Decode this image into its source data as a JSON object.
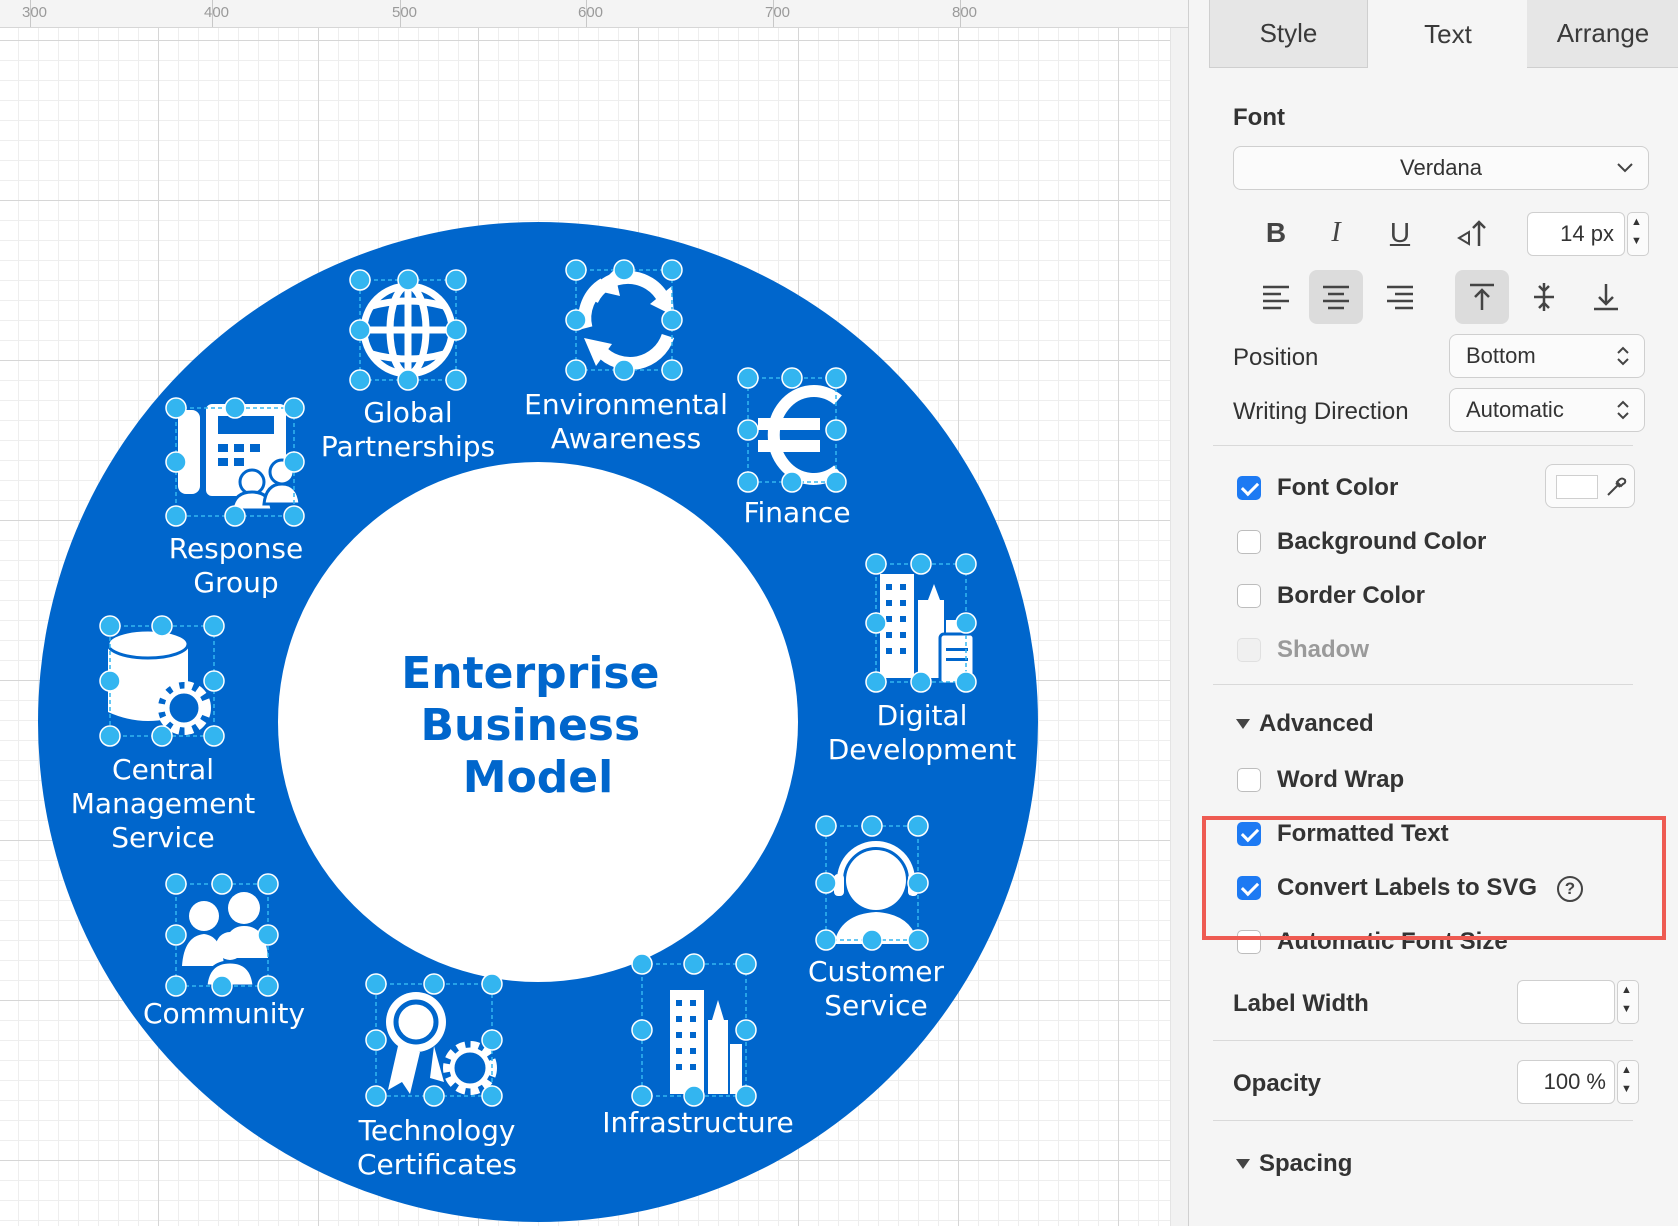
{
  "ruler": {
    "marks": [
      "300",
      "400",
      "500",
      "600",
      "700",
      "800"
    ]
  },
  "diagram": {
    "center_title": [
      "Enterprise",
      "Business",
      "Model"
    ],
    "ring_color": "#0066cc",
    "handle_color": "#33b5f0",
    "nodes": [
      {
        "id": "global-partnerships",
        "icon": "globe-icon",
        "label": [
          "Global",
          "Partnerships"
        ]
      },
      {
        "id": "environmental-awareness",
        "icon": "recycle-arrows-icon",
        "label": [
          "Environmental",
          "Awareness"
        ]
      },
      {
        "id": "finance",
        "icon": "euro-icon",
        "label": [
          "Finance"
        ]
      },
      {
        "id": "digital-development",
        "icon": "city-buildings-icon",
        "label": [
          "Digital",
          "Development"
        ]
      },
      {
        "id": "customer-service",
        "icon": "headset-agent-icon",
        "label": [
          "Customer",
          "Service"
        ]
      },
      {
        "id": "infrastructure",
        "icon": "skyscraper-icon",
        "label": [
          "Infrastructure"
        ]
      },
      {
        "id": "technology-certificates",
        "icon": "award-gear-icon",
        "label": [
          "Technology",
          "Certificates"
        ]
      },
      {
        "id": "community",
        "icon": "people-group-icon",
        "label": [
          "Community"
        ]
      },
      {
        "id": "central-management-service",
        "icon": "database-gear-icon",
        "label": [
          "Central",
          "Management",
          "Service"
        ]
      },
      {
        "id": "response-group",
        "icon": "phone-users-icon",
        "label": [
          "Response",
          "Group"
        ]
      }
    ]
  },
  "panel": {
    "tabs": [
      {
        "label": "Style",
        "active": false
      },
      {
        "label": "Text",
        "active": true
      },
      {
        "label": "Arrange",
        "active": false
      }
    ],
    "font_section_label": "Font",
    "font_family": "Verdana",
    "font_size": "14 px",
    "format_buttons": {
      "bold": "B",
      "italic": "I",
      "underline": "U"
    },
    "position_label": "Position",
    "position_value": "Bottom",
    "writing_direction_label": "Writing Direction",
    "writing_direction_value": "Automatic",
    "font_color_label": "Font Color",
    "font_color_checked": true,
    "font_color_value": "#ffffff",
    "background_color_label": "Background Color",
    "border_color_label": "Border Color",
    "shadow_label": "Shadow",
    "advanced_label": "Advanced",
    "word_wrap_label": "Word Wrap",
    "formatted_text_label": "Formatted Text",
    "convert_labels_label": "Convert Labels to SVG",
    "help_glyph": "?",
    "auto_font_size_label": "Automatic Font Size",
    "label_width_label": "Label Width",
    "label_width_value": "",
    "opacity_label": "Opacity",
    "opacity_value": "100 %",
    "spacing_label": "Spacing",
    "highlight_color": "#ee5b52",
    "checkbox_color": "#1d7af3"
  }
}
